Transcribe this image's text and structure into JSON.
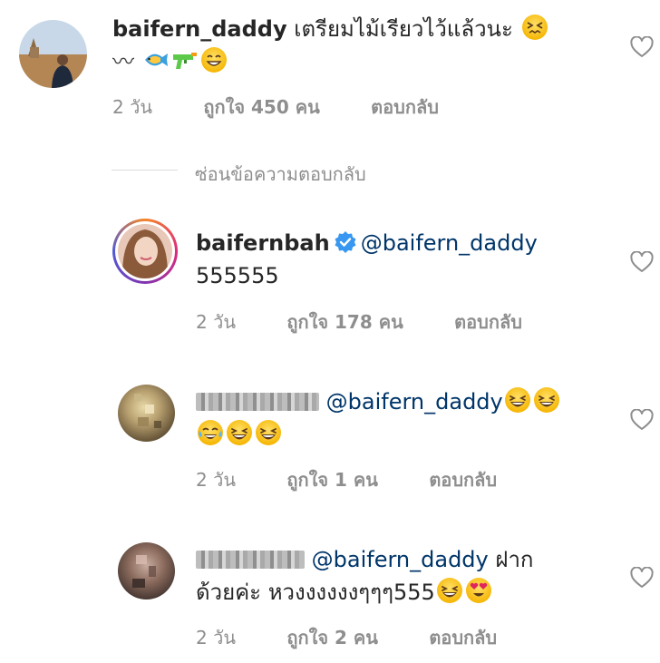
{
  "comments": [
    {
      "username": "baifern_daddy",
      "text": "เตรียมไม้เรียวไว้แล้วนะ",
      "line2": "〰",
      "time": "2 วัน",
      "likes": "ถูกใจ 450 คน",
      "reply": "ตอบกลับ",
      "emojis": [
        "confounded-face",
        "tropical-fish",
        "water-pistol",
        "grinning-face"
      ]
    },
    {
      "username": "baifernbah",
      "verified": true,
      "mention": "@baifern_daddy",
      "text": "555555",
      "time": "2 วัน",
      "likes": "ถูกใจ 178 คน",
      "reply": "ตอบกลับ"
    },
    {
      "username_blurred": true,
      "mention": "@baifern_daddy",
      "time": "2 วัน",
      "likes": "ถูกใจ 1 คน",
      "reply": "ตอบกลับ",
      "emojis": [
        "laughing-face",
        "laughing-face",
        "tears-of-joy-face",
        "laughing-face",
        "laughing-face"
      ]
    },
    {
      "username_blurred": true,
      "mention": "@baifern_daddy",
      "text": "ฝาก",
      "line2": "ด้วยค่ะ หวงงงงงงๆๆๆ555",
      "time": "2 วัน",
      "likes": "ถูกใจ 2 คน",
      "reply": "ตอบกลับ",
      "emojis": [
        "laughing-face",
        "heart-eyes-face"
      ]
    }
  ],
  "hide_replies": "ซ่อนข้อความตอบกลับ",
  "colors": {
    "mention": "#003569",
    "meta": "#8e8e8e",
    "verified": "#3897f0"
  }
}
